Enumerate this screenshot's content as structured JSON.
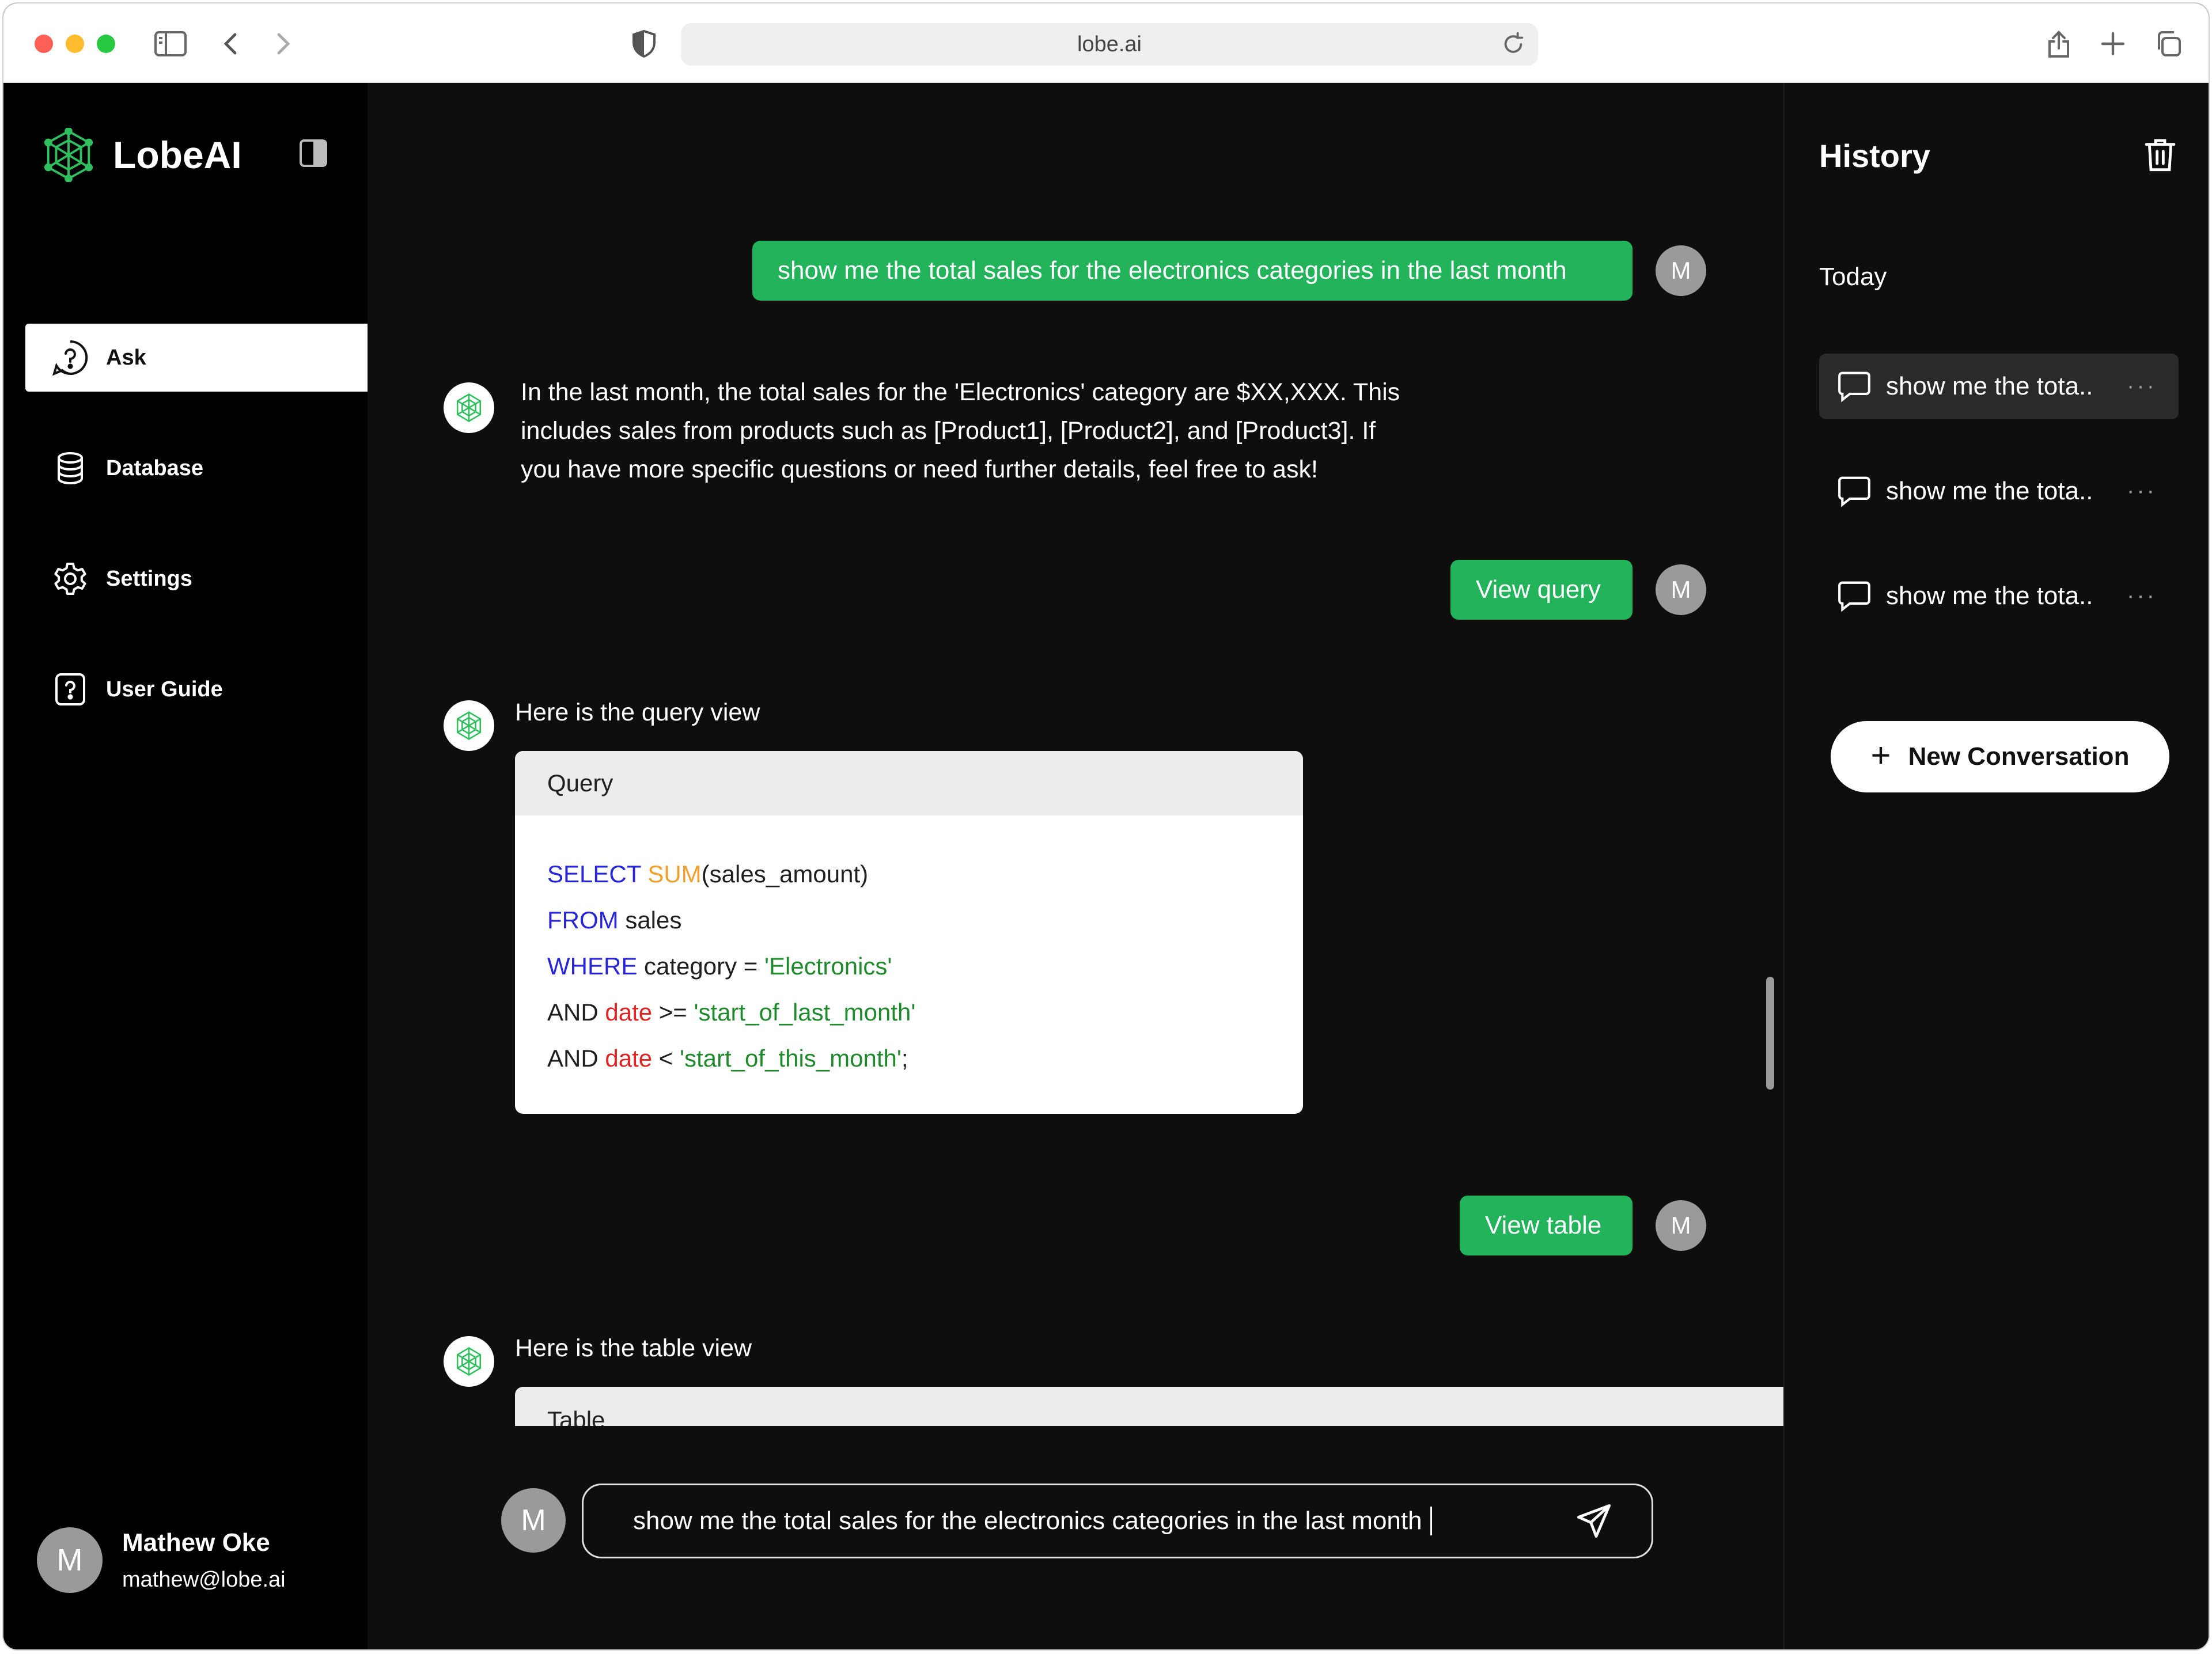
{
  "browser": {
    "url": "lobe.ai"
  },
  "app": {
    "name": "LobeAI",
    "accent_color": "#22b35b"
  },
  "nav": {
    "items": [
      {
        "label": "Ask",
        "icon": "help-circle-icon",
        "active": true
      },
      {
        "label": "Database",
        "icon": "database-icon"
      },
      {
        "label": "Settings",
        "icon": "gear-icon"
      },
      {
        "label": "User Guide",
        "icon": "help-square-icon"
      }
    ]
  },
  "user": {
    "initial": "M",
    "name": "Mathew Oke",
    "email": "mathew@lobe.ai"
  },
  "chat": {
    "messages": {
      "user_question": "show me the total sales for the electronics categories in the last month",
      "bot_answer_line1": "In the last month, the total sales for the 'Electronics' category are $XX,XXX. This",
      "bot_answer_line2": "includes sales from products such as [Product1], [Product2], and [Product3]. If",
      "bot_answer_line3": "you have more specific questions or need further details, feel free to ask!",
      "view_query": "View query",
      "query_intro": "Here is the query view",
      "view_table": "View table",
      "table_intro": "Here is the table view"
    },
    "query_card": {
      "title": "Query",
      "lines": [
        {
          "t1": "SELECT",
          "t2": "SUM",
          "t3": "(sales_amount)"
        },
        {
          "t1": "FROM",
          "t2": " sales"
        },
        {
          "t1": "WHERE",
          "t2": " category = ",
          "t3": "'Electronics'"
        },
        {
          "t1": "AND ",
          "t2": "date",
          "t3": " >= ",
          "t4": "'start_of_last_month'"
        },
        {
          "t1": "AND ",
          "t2": "date",
          "t3": " < ",
          "t4": "'start_of_this_month'",
          "t5": ";"
        }
      ]
    },
    "table_card": {
      "title": "Table"
    },
    "input": {
      "value": "show me the total sales for the electronics categories in the last month"
    }
  },
  "history": {
    "title": "History",
    "section": "Today",
    "items": [
      {
        "label": "show me the tota..",
        "active": true
      },
      {
        "label": "show me the tota.."
      },
      {
        "label": "show me the tota.."
      }
    ],
    "more_glyph": "···",
    "new_conversation": "New Conversation"
  }
}
